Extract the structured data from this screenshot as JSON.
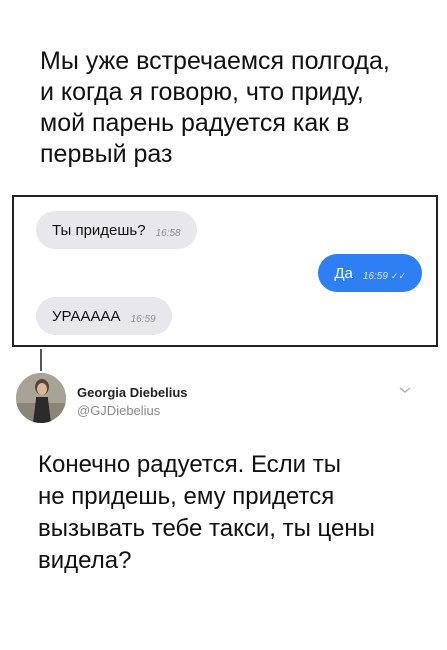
{
  "post": {
    "text": "Мы уже встречаемся полгода,\nи когда я говорю, что приду,\nмой парень радуется как в\nпервый раз"
  },
  "chat": {
    "messages": [
      {
        "text": "Ты придешь?",
        "time": "16:58",
        "direction": "incoming"
      },
      {
        "text": "Да",
        "time": "16:59",
        "direction": "outgoing",
        "status_icon": "double-check-icon"
      },
      {
        "text": "УРААААА",
        "time": "16:59",
        "direction": "incoming"
      }
    ]
  },
  "reply": {
    "author_name": "Georgia Diebelius",
    "author_handle": "@GJDiebelius",
    "text": "Конечно радуется. Если ты\nне придешь, ему придется\nвызывать тебе такси, ты цены\nвидела?",
    "menu_icon": "chevron-down-icon"
  },
  "colors": {
    "outgoing_bubble": "#2e7ef4",
    "incoming_bubble": "#e8e8ec",
    "handle": "#8a8a8a"
  }
}
